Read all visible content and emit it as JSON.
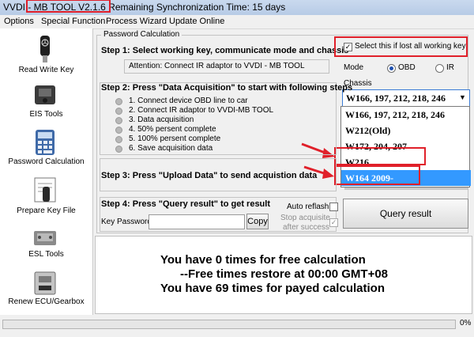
{
  "window": {
    "title": "VVDI - MB TOOL V2.1.6   Remaining Synchronization Time: 15 days"
  },
  "menu": [
    "Options",
    "Special Function",
    "Process Wizard",
    "Update Online"
  ],
  "sidebar": {
    "items": [
      {
        "label": "Read Write Key",
        "icon": "mercedes-key-icon"
      },
      {
        "label": "EIS Tools",
        "icon": "eis-module-icon"
      },
      {
        "label": "Password Calculation",
        "icon": "calculator-icon"
      },
      {
        "label": "Prepare Key File",
        "icon": "key-file-icon"
      },
      {
        "label": "ESL Tools",
        "icon": "esl-module-icon"
      },
      {
        "label": "Renew ECU/Gearbox",
        "icon": "ecu-icon"
      }
    ]
  },
  "password_calc": {
    "group_title": "Password Calculation",
    "step1": "Step 1: Select working key, communicate mode and chassis",
    "lost_keys_label": "Select this if lost all working key",
    "lost_keys_checked": true,
    "attention": "Attention: Connect IR adaptor to VVDI - MB TOOL",
    "mode_label": "Mode",
    "mode_options": [
      "OBD",
      "IR"
    ],
    "mode_selected": "OBD",
    "chassis_label": "Chassis",
    "chassis_selected": "W166, 197, 212, 218, 246",
    "chassis_options": [
      "W166, 197, 212, 218, 246",
      "W212(Old)",
      "W172, 204, 207",
      "W216",
      "W164 2009-"
    ],
    "chassis_highlighted": "W164 2009-",
    "step2": "Step 2: Press \"Data Acquisition\" to start with following steps",
    "step2_items": [
      "1. Connect device OBD line to car",
      "2. Connect IR adaptor to VVDI-MB TOOL",
      "3. Data acquisition",
      "4. 50%  persent complete",
      "5. 100% persent complete",
      "6. Save acquisition data"
    ],
    "step3": "Step 3: Press \"Upload Data\" to send acquistion data",
    "step4": "Step 4: Press \"Query result\" to get result",
    "auto_refresh_label": "Auto reflash",
    "auto_refresh_checked": false,
    "stop_acquisite_label_1": "Stop acquisite",
    "stop_acquisite_label_2": "after success",
    "stop_acquisite_checked": true,
    "key_password_label": "Key Password",
    "key_password_value": "",
    "copy_button": "Copy",
    "query_button": "Query result"
  },
  "info": {
    "line1": "You have 0 times for free calculation",
    "line2": "--Free times restore at 00:00 GMT+08",
    "line3": "You have 69 times for payed calculation"
  },
  "progress": {
    "percent_text": "0%",
    "value": 0
  },
  "colors": {
    "highlight_red": "#e0202a",
    "selected_blue": "#3399ff",
    "title_bar": "#c9d9ee"
  }
}
